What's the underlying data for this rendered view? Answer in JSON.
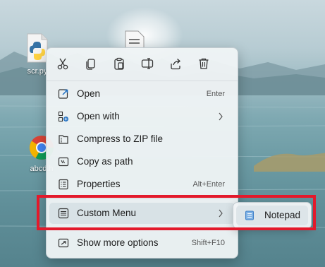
{
  "desktop": {
    "icons": [
      {
        "label": "scr.py",
        "icon": "python-file-icon"
      },
      {
        "label": "abcd.h",
        "icon": "chrome-icon"
      }
    ]
  },
  "context_menu": {
    "toolbar": [
      {
        "name": "cut-icon"
      },
      {
        "name": "copy-icon"
      },
      {
        "name": "paste-icon"
      },
      {
        "name": "rename-icon"
      },
      {
        "name": "share-icon"
      },
      {
        "name": "delete-icon"
      }
    ],
    "items": [
      {
        "label": "Open",
        "shortcut": "Enter"
      },
      {
        "label": "Open with",
        "shortcut": ""
      },
      {
        "label": "Compress to ZIP file",
        "shortcut": ""
      },
      {
        "label": "Copy as path",
        "shortcut": ""
      },
      {
        "label": "Properties",
        "shortcut": "Alt+Enter"
      },
      {
        "label": "Custom Menu",
        "shortcut": ""
      },
      {
        "label": "Show more options",
        "shortcut": "Shift+F10"
      }
    ]
  },
  "submenu": {
    "items": [
      {
        "label": "Notepad"
      }
    ]
  },
  "colors": {
    "highlight_border": "#e3192b",
    "accent": "#1f6fc2"
  }
}
